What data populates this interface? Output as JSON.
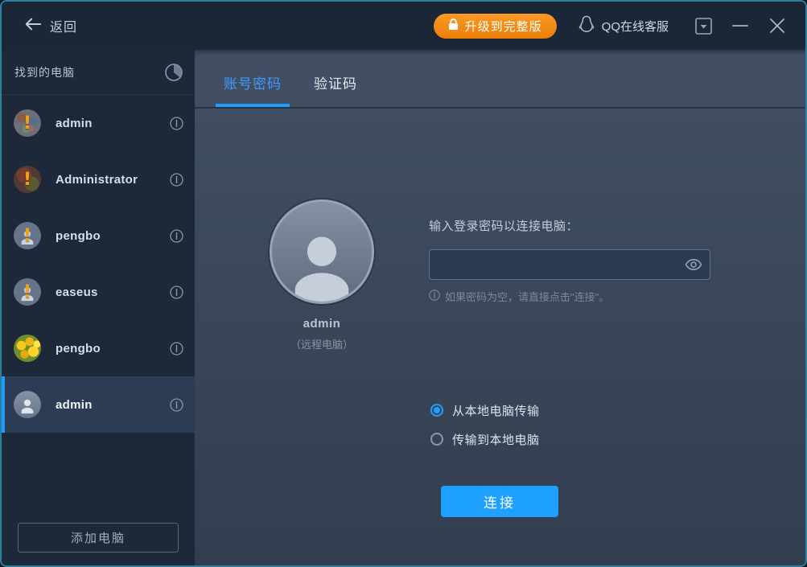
{
  "topbar": {
    "back_label": "返回",
    "upgrade_label": "升级到完整版",
    "qq_label": "QQ在线客服"
  },
  "sidebar": {
    "header": "找到的电脑",
    "add_button_label": "添加电脑",
    "computers": [
      {
        "name": "admin",
        "avatar": "photo-noise",
        "ring": true,
        "alert": true,
        "selected": false
      },
      {
        "name": "Administrator",
        "avatar": "photo-dark",
        "ring": true,
        "alert": true,
        "selected": false
      },
      {
        "name": "pengbo",
        "avatar": "person",
        "ring": true,
        "alert": true,
        "selected": false
      },
      {
        "name": "easeus",
        "avatar": "person",
        "ring": true,
        "alert": true,
        "selected": false
      },
      {
        "name": "pengbo",
        "avatar": "flowers",
        "ring": false,
        "alert": false,
        "selected": false
      },
      {
        "name": "admin",
        "avatar": "person-plain",
        "ring": false,
        "alert": false,
        "selected": true
      }
    ]
  },
  "tabs": [
    {
      "label": "账号密码",
      "active": true
    },
    {
      "label": "验证码",
      "active": false
    }
  ],
  "panel": {
    "remote_user": "admin",
    "remote_user_sub": "（远程电脑）",
    "password_label": "输入登录密码以连接电脑：",
    "password_value": "",
    "hint": "如果密码为空，请直接点击\"连接\"。",
    "transfer_options": [
      {
        "label": "从本地电脑传输",
        "checked": true
      },
      {
        "label": "传输到本地电脑",
        "checked": false
      }
    ],
    "connect_label": "连接"
  },
  "icons": {
    "alert_glyph": "!"
  },
  "colors": {
    "accent_blue": "#1e9fff",
    "upgrade_orange": "#ee8410",
    "alert_orange": "#f6a11c",
    "window_border": "#2e7f9f"
  }
}
